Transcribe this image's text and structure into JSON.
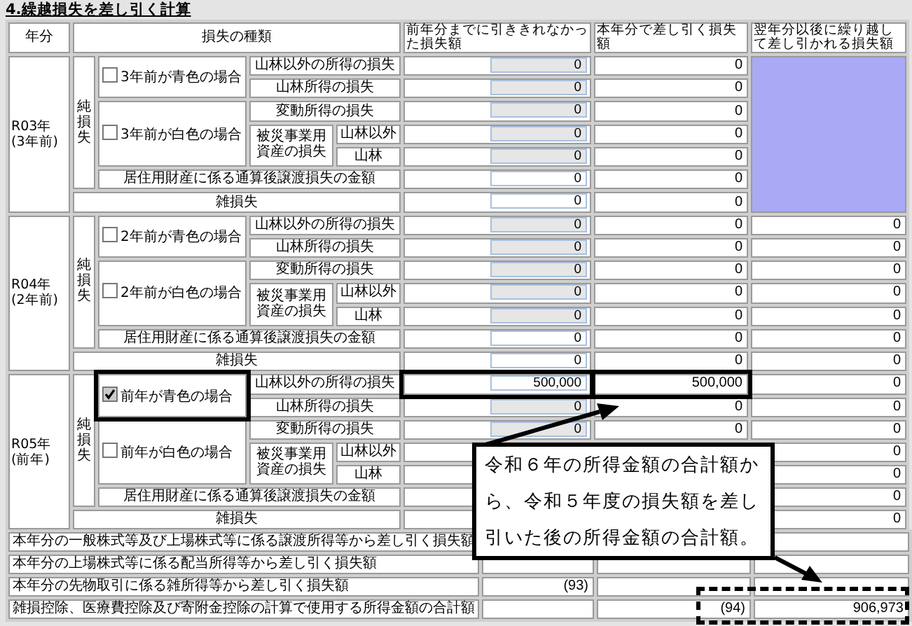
{
  "title": "4.繰越損失を差し引く計算",
  "columns": [
    "年分",
    "損失の種類",
    "前年分までに引ききれなかった損失額",
    "本年分で差し引く損失額",
    "翌年分以後に繰り越して差し引かれる損失額"
  ],
  "years": [
    {
      "year": "R03年",
      "year_note": "(3年前)",
      "net_loss_label": "純損失",
      "blue": {
        "label": "3年前が青色の場合",
        "checked": false,
        "highlighted": false
      },
      "white": {
        "label": "3年前が白色の場合",
        "checked": false
      },
      "disaster_label": "被災事業用資産の損失",
      "carryover_shaded": true,
      "rows": [
        {
          "label": "山林以外の所得の損失",
          "prior": "0",
          "prior_disabled": true,
          "current": "0",
          "highlighted": false
        },
        {
          "label": "山林所得の損失",
          "prior": "0",
          "prior_disabled": true,
          "current": "0",
          "highlighted": false
        },
        {
          "label": "変動所得の損失",
          "prior": "0",
          "prior_disabled": true,
          "current": "0",
          "highlighted": false
        },
        {
          "label": "山林以外",
          "prior": "0",
          "prior_disabled": true,
          "current": "0",
          "highlighted": false
        },
        {
          "label": "山林",
          "prior": "0",
          "prior_disabled": true,
          "current": "0",
          "highlighted": false
        },
        {
          "label": "居住用財産に係る通算後譲渡損失の金額",
          "prior": "0",
          "prior_disabled": false,
          "current": "0",
          "highlighted": false
        },
        {
          "label": "雑損失",
          "prior": "0",
          "prior_disabled": false,
          "current": "0",
          "highlighted": false
        }
      ]
    },
    {
      "year": "R04年",
      "year_note": "(2年前)",
      "net_loss_label": "純損失",
      "blue": {
        "label": "2年前が青色の場合",
        "checked": false,
        "highlighted": false
      },
      "white": {
        "label": "2年前が白色の場合",
        "checked": false
      },
      "disaster_label": "被災事業用資産の損失",
      "carryover_shaded": false,
      "rows": [
        {
          "label": "山林以外の所得の損失",
          "prior": "0",
          "prior_disabled": true,
          "current": "0",
          "carryover": "0",
          "highlighted": false
        },
        {
          "label": "山林所得の損失",
          "prior": "0",
          "prior_disabled": true,
          "current": "0",
          "carryover": "0",
          "highlighted": false
        },
        {
          "label": "変動所得の損失",
          "prior": "0",
          "prior_disabled": true,
          "current": "0",
          "carryover": "0",
          "highlighted": false
        },
        {
          "label": "山林以外",
          "prior": "0",
          "prior_disabled": true,
          "current": "0",
          "carryover": "0",
          "highlighted": false
        },
        {
          "label": "山林",
          "prior": "0",
          "prior_disabled": true,
          "current": "0",
          "carryover": "0",
          "highlighted": false
        },
        {
          "label": "居住用財産に係る通算後譲渡損失の金額",
          "prior": "0",
          "prior_disabled": false,
          "current": "0",
          "carryover": "0",
          "highlighted": false
        },
        {
          "label": "雑損失",
          "prior": "0",
          "prior_disabled": false,
          "current": "0",
          "carryover": "0",
          "highlighted": false
        }
      ]
    },
    {
      "year": "R05年",
      "year_note": "(前年)",
      "net_loss_label": "純損失",
      "blue": {
        "label": "前年が青色の場合",
        "checked": true,
        "highlighted": true
      },
      "white": {
        "label": "前年が白色の場合",
        "checked": false
      },
      "disaster_label": "被災事業用資産の損失",
      "carryover_shaded": false,
      "rows": [
        {
          "label": "山林以外の所得の損失",
          "prior": "500,000",
          "prior_disabled": false,
          "current": "500,000",
          "carryover": "0",
          "highlighted": true
        },
        {
          "label": "山林所得の損失",
          "prior": "0",
          "prior_disabled": true,
          "current": "0",
          "carryover": "0",
          "highlighted": false
        },
        {
          "label": "変動所得の損失",
          "prior": "0",
          "prior_disabled": true,
          "current": "0",
          "carryover": "0",
          "highlighted": false
        },
        {
          "label": "山林以外",
          "carryover": "0",
          "highlighted": false
        },
        {
          "label": "山林",
          "carryover": "0",
          "highlighted": false
        },
        {
          "label": "居住用財産に係る通算後譲渡損失の金額",
          "carryover": "0",
          "highlighted": false
        },
        {
          "label": "雑損失",
          "carryover": "0",
          "highlighted": false
        }
      ]
    }
  ],
  "totals": [
    {
      "label": "本年分の一般株式等及び上場株式等に係る譲渡所得等から差し引く損失額"
    },
    {
      "label": "本年分の上場株式等に係る配当所得等から差し引く損失額"
    },
    {
      "label": "本年分の先物取引に係る雑所得等から差し引く損失額",
      "prior": "(93)"
    },
    {
      "label": "雑損控除、医療費控除及び寄附金控除の計算で使用する所得金額の合計額",
      "current": "(94)",
      "carryover": "906,973"
    }
  ],
  "callout": {
    "text": "令和６年の所得金額の合計額から、令和５年度の損失額を差し引いた後の所得金額の合計額。"
  }
}
